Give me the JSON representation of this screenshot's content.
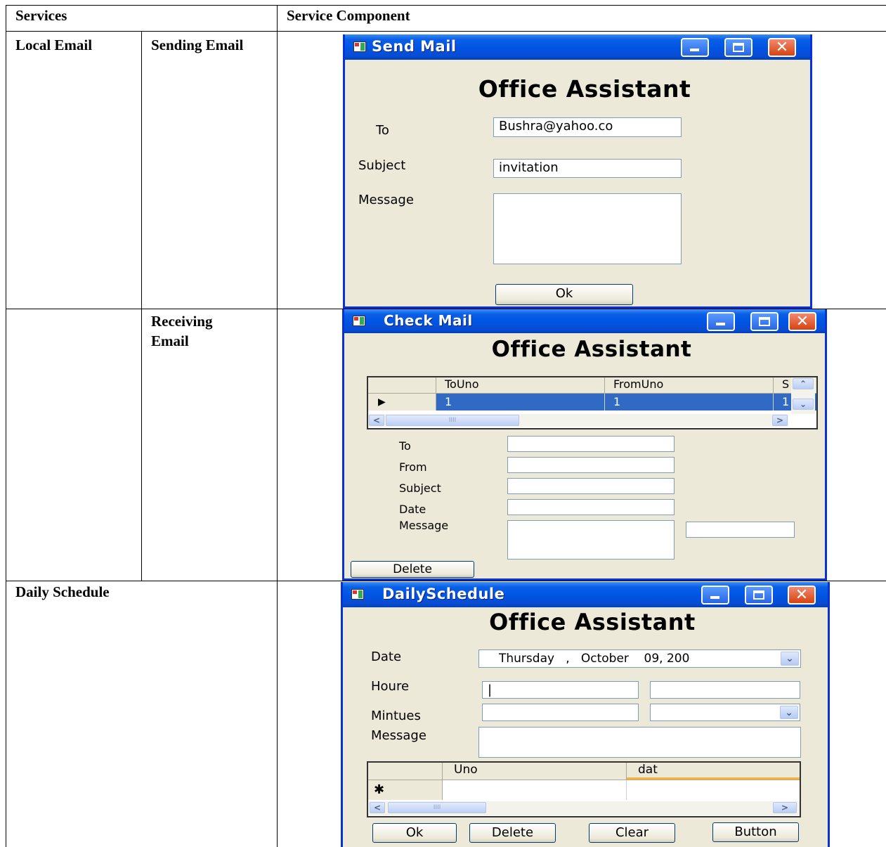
{
  "table": {
    "header_services": "Services",
    "header_component": "Service Component",
    "row1_service": "Local Email",
    "row1_sub": "Sending Email",
    "row2_sub_line1": "Receiving",
    "row2_sub_line2": "Email",
    "row3_service": "Daily Schedule"
  },
  "send_mail": {
    "title": "Send Mail",
    "heading": "Office Assistant",
    "to_label": "To",
    "to_value": "Bushra@yahoo.co",
    "subject_label": "Subject",
    "subject_value": "invitation",
    "message_label": "Message",
    "message_value": "",
    "ok_label": "Ok"
  },
  "check_mail": {
    "title": "Check Mail",
    "heading": "Office Assistant",
    "grid_columns": [
      "ToUno",
      "FromUno",
      "S"
    ],
    "grid_rows": [
      [
        "1",
        "1",
        "1"
      ]
    ],
    "row_marker": "▶",
    "scroll_thumb_mark": "IIII",
    "to_label": "To",
    "from_label": "From",
    "subject_label": "Subject",
    "date_label": "Date",
    "message_label": "Message",
    "delete_label": "Delete"
  },
  "daily_schedule": {
    "title": "DailySchedule",
    "heading": "Office Assistant",
    "date_label": "Date",
    "date_value": "Thursday   ,   October    09, 200",
    "houre_label": "Houre",
    "houre_value": "|",
    "mintues_label": "Mintues",
    "message_label": "Message",
    "grid_columns": [
      "Uno",
      "dat"
    ],
    "new_row_marker": "✱",
    "scroll_thumb_mark": "IIII",
    "ok_label": "Ok",
    "delete_label": "Delete",
    "clear_label": "Clear",
    "button_label": "Button"
  },
  "colors": {
    "titlebar_blue": "#0054e3",
    "window_face": "#ece9d8",
    "selection_blue": "#316ac5",
    "close_red": "#d7420f"
  }
}
